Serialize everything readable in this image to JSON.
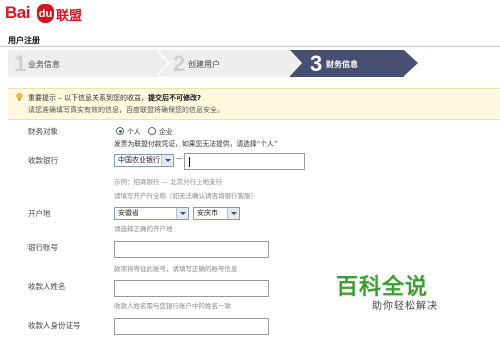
{
  "header": {
    "logo_text": "Baidu联盟"
  },
  "page_title": "用户注册",
  "steps": [
    {
      "num": "1",
      "label": "业务信息",
      "active": false
    },
    {
      "num": "2",
      "label": "创建用户",
      "active": false
    },
    {
      "num": "3",
      "label": "财务信息",
      "active": true
    }
  ],
  "tip": {
    "prefix": "重要提示 – 以下信息关系到您的收益，",
    "emphasis": "提交后不可修改?",
    "line2": "请您准确填写真实有效的信息，百度联盟将确保您的信息安全。"
  },
  "form": {
    "account_type": {
      "label": "财务对象",
      "options": [
        "个人",
        "企业"
      ],
      "selected": "个人",
      "help": "发票为联盟付款凭证，如果您无法提供，请选择“个人”"
    },
    "bank": {
      "label": "收款银行",
      "value": "中国农业银行",
      "separator": "—",
      "input_value": "",
      "help1": "示例：招商银行 — 北京分行上地支行",
      "help2": "请填写开户行全称（如无法确认请咨询银行客服）"
    },
    "location": {
      "label": "开户地",
      "province": "安徽省",
      "city": "安庆市",
      "help": "请选择正确的开户地"
    },
    "account_number": {
      "label": "银行账号",
      "value": "",
      "help": "款项将寄往此账号，请填写正确的账号信息"
    },
    "payee_name": {
      "label": "收款人姓名",
      "value": "",
      "help": "收款人姓名需与您银行账户中的姓名一致"
    },
    "payee_id": {
      "label": "收款人身份证号",
      "value": ""
    }
  },
  "watermark": {
    "title": "百科全说",
    "subtitle": "助你轻松解决"
  },
  "colors": {
    "brand_red": "#d9141e",
    "active_step": "#475073",
    "tip_bg": "#fdf8de",
    "watermark_green": "#3aa12f"
  }
}
